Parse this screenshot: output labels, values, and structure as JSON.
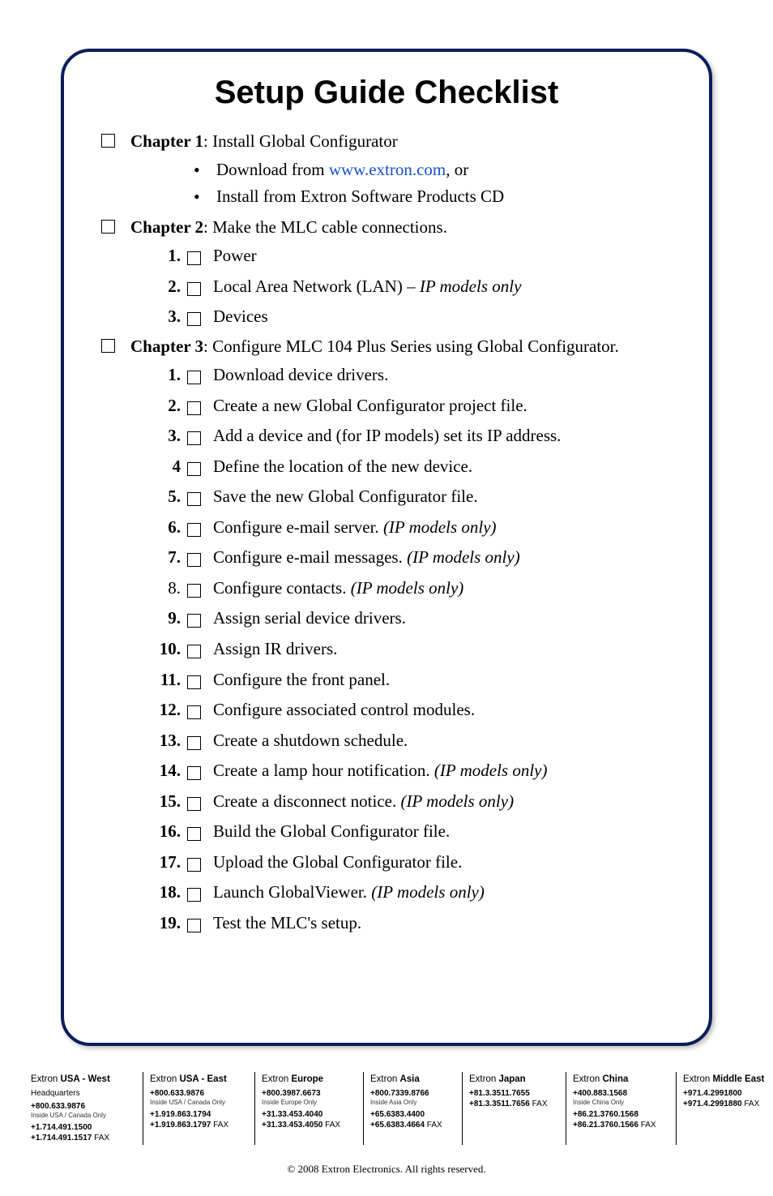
{
  "title": "Setup Guide Checklist",
  "chapters": [
    {
      "heading_bold": "Chapter 1",
      "heading_rest": ": Install Global Configurator",
      "bullets": [
        {
          "pre": "Download from ",
          "link": "www.extron.com",
          "post": ", or"
        },
        {
          "text": "Install from Extron Software Products CD"
        }
      ]
    },
    {
      "heading_bold": "Chapter 2",
      "heading_rest": ": Make the MLC cable connections.",
      "items": [
        {
          "n": "1.",
          "text": "Power"
        },
        {
          "n": "2.",
          "text": "Local Area Network (LAN) – ",
          "ital": "IP models only"
        },
        {
          "n": "3.",
          "text": "Devices"
        }
      ]
    },
    {
      "heading_bold": "Chapter 3",
      "heading_rest": ": Configure MLC 104 Plus Series using Global Configurator.",
      "items": [
        {
          "n": "1.",
          "text": "Download device drivers."
        },
        {
          "n": "2.",
          "text": "Create a new Global Configurator project file."
        },
        {
          "n": "3.",
          "text": "Add a device and (for IP models) set its IP address."
        },
        {
          "n": "4",
          "text": "Define the location of the new device."
        },
        {
          "n": "5.",
          "text": "Save the new Global Configurator file."
        },
        {
          "n": "6.",
          "text": "Configure e-mail server.  ",
          "ital": "(IP models only)"
        },
        {
          "n": "7.",
          "text": "Configure e-mail messages. ",
          "ital": "(IP models only)"
        },
        {
          "n": "8.",
          "nbold": false,
          "text": "Configure contacts. ",
          "ital": "(IP models only)"
        },
        {
          "n": "9.",
          "text": "Assign serial device drivers."
        },
        {
          "n": "10.",
          "text": "Assign IR drivers."
        },
        {
          "n": "11.",
          "text": "Configure the front panel."
        },
        {
          "n": "12.",
          "text": "Configure associated control modules."
        },
        {
          "n": "13.",
          "text": "Create a shutdown schedule."
        },
        {
          "n": "14.",
          "text": "Create a lamp hour notification. ",
          "ital": "(IP models only)"
        },
        {
          "n": "15.",
          "text": "Create a disconnect notice. ",
          "ital": "(IP models only)"
        },
        {
          "n": "16.",
          "text": "Build the Global Configurator file."
        },
        {
          "n": "17.",
          "text": "Upload the Global Configurator file."
        },
        {
          "n": "18.",
          "text": "Launch GlobalViewer. ",
          "ital": "(IP models only)"
        },
        {
          "n": "19.",
          "text": "Test the MLC's setup."
        }
      ]
    }
  ],
  "footer": {
    "regions": [
      {
        "name_pre": "Extron ",
        "name_bold": "USA - West",
        "sub": "Headquarters",
        "p1": "+800.633.9876",
        "p1note": "Inside USA / Canada Only",
        "p2": "+1.714.491.1500",
        "fax": "+1.714.491.1517",
        "faxlbl": " FAX"
      },
      {
        "name_pre": "Extron ",
        "name_bold": "USA - East",
        "p1": "+800.633.9876",
        "p1note": "Inside USA / Canada Only",
        "p2": "+1.919.863.1794",
        "fax": "+1.919.863.1797",
        "faxlbl": " FAX"
      },
      {
        "name_pre": "Extron ",
        "name_bold": "Europe",
        "p1": "+800.3987.6673",
        "p1note": "Inside Europe Only",
        "p2": "+31.33.453.4040",
        "fax": "+31.33.453.4050",
        "faxlbl": " FAX"
      },
      {
        "name_pre": "Extron ",
        "name_bold": "Asia",
        "p1": "+800.7339.8766",
        "p1note": "Inside Asia Only",
        "p2": "+65.6383.4400",
        "fax": "+65.6383.4664",
        "faxlbl": " FAX"
      },
      {
        "name_pre": "Extron ",
        "name_bold": "Japan",
        "p1": "+81.3.3511.7655",
        "fax": "+81.3.3511.7656",
        "faxlbl": " FAX"
      },
      {
        "name_pre": "Extron ",
        "name_bold": "China",
        "p1": "+400.883.1568",
        "p1note": "Inside China Only",
        "p2": "+86.21.3760.1568",
        "fax": "+86.21.3760.1566",
        "faxlbl": " FAX"
      },
      {
        "name_pre": "Extron ",
        "name_bold": "Middle East",
        "p1": "+971.4.2991800",
        "fax": "+971.4.2991880",
        "faxlbl": " FAX"
      }
    ],
    "copyright": "© 2008  Extron Electronics.  All rights reserved."
  }
}
